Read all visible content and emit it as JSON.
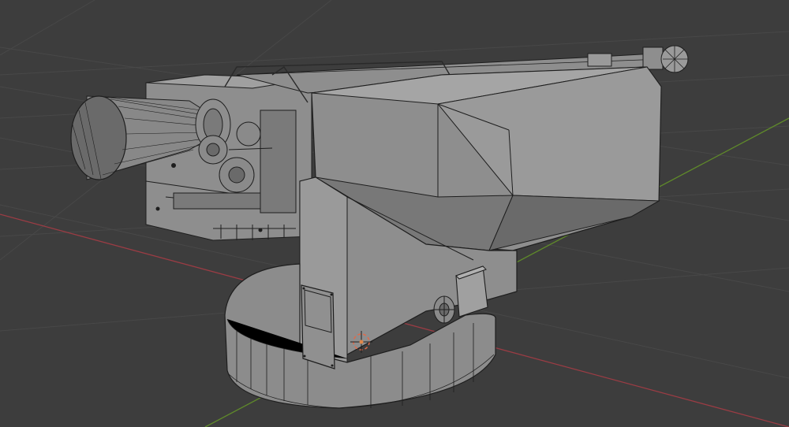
{
  "viewport": {
    "background": "#3d3d3d",
    "grid_color": "#484848",
    "x_axis_color": "#9a3c44",
    "y_axis_color": "#5f8a2a",
    "mesh_fill": "#8e8e8e",
    "mesh_fill_light": "#a0a0a0",
    "mesh_fill_dark": "#6a6a6a",
    "wire_color": "#1e1e1e",
    "origin_color": "#e0874a",
    "show_wireframe": true
  },
  "object": {
    "type": "mesh",
    "name": "",
    "parts": [
      "cannon-barrel",
      "turret-housing",
      "turret-base",
      "dish-antenna",
      "rear-equipment-block",
      "access-panel",
      "side-hatch",
      "vent-wheel"
    ]
  },
  "icons": {
    "origin": "object-origin-icon",
    "cursor": "3d-cursor-icon"
  }
}
